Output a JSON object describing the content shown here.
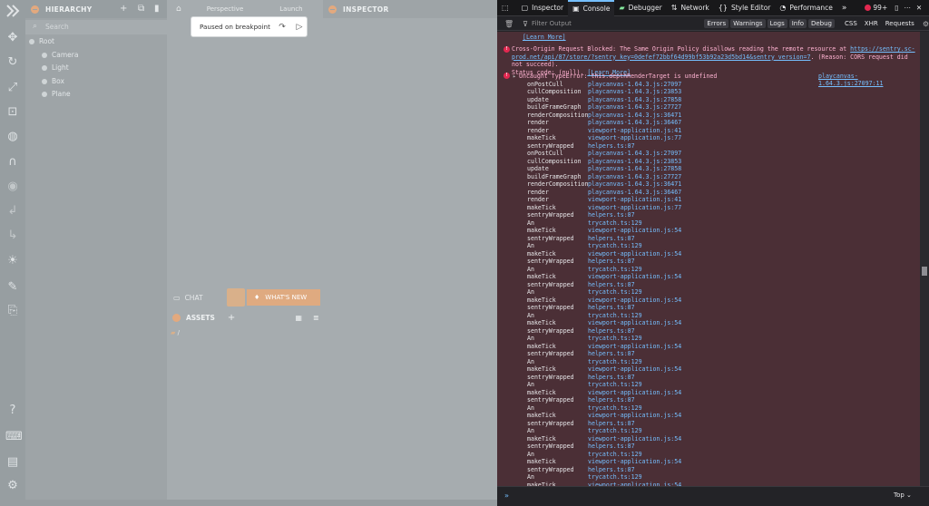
{
  "editor": {
    "hierarchy_title": "HIERARCHY",
    "search_placeholder": "Search",
    "tree": [
      "Root",
      "Camera",
      "Light",
      "Box",
      "Plane"
    ],
    "viewport_camera": "Perspective",
    "launch_label": "Launch",
    "inspector_title": "INSPECTOR",
    "paused_text": "Paused on breakpoint",
    "chat_label": "CHAT",
    "whats_new_label": "WHAT'S NEW",
    "assets_title": "ASSETS",
    "assets_path": "/"
  },
  "devtools": {
    "tabs": [
      {
        "label": "Inspector",
        "icon": "inspector-icon"
      },
      {
        "label": "Console",
        "icon": "console-icon"
      },
      {
        "label": "Debugger",
        "icon": "debugger-icon"
      },
      {
        "label": "Network",
        "icon": "network-icon"
      },
      {
        "label": "Style Editor",
        "icon": "style-editor-icon"
      },
      {
        "label": "Performance",
        "icon": "performance-icon"
      }
    ],
    "active_tab": "Console",
    "error_badge": "99+",
    "filter_placeholder": "Filter Output",
    "filters": [
      "Errors",
      "Warnings",
      "Logs",
      "Info",
      "Debug",
      "CSS",
      "XHR",
      "Requests"
    ],
    "learn_more": "[Learn More]",
    "cors_error": {
      "prefix": "Cross-Origin Request Blocked: The Same Origin Policy disallows reading the remote resource at ",
      "url": "https://sentry.sc-prod.net/api/87/store/?sentry_key=0defef72bbf64d99bf53b92a23d5bd14&sentry_version=7",
      "suffix": ". (Reason: CORS request did not succeed).",
      "status": "Status code: (null).",
      "learn_more": "[Learn More]"
    },
    "type_error": {
      "message": "Uncaught TypeError: this.depthRenderTarget is undefined",
      "location": "playcanvas-1.64.3.js:27097:11"
    },
    "stack": [
      [
        "onPostCull",
        "playcanvas-1.64.3.js:27097"
      ],
      [
        "cullComposition",
        "playcanvas-1.64.3.js:23853"
      ],
      [
        "update",
        "playcanvas-1.64.3.js:27858"
      ],
      [
        "buildFrameGraph",
        "playcanvas-1.64.3.js:27727"
      ],
      [
        "renderComposition",
        "playcanvas-1.64.3.js:36471"
      ],
      [
        "render",
        "playcanvas-1.64.3.js:36467"
      ],
      [
        "render",
        "viewport-application.js:41"
      ],
      [
        "makeTick",
        "viewport-application.js:77"
      ],
      [
        "sentryWrapped",
        "helpers.ts:87"
      ],
      [
        "onPostCull",
        "playcanvas-1.64.3.js:27097"
      ],
      [
        "cullComposition",
        "playcanvas-1.64.3.js:23853"
      ],
      [
        "update",
        "playcanvas-1.64.3.js:27858"
      ],
      [
        "buildFrameGraph",
        "playcanvas-1.64.3.js:27727"
      ],
      [
        "renderComposition",
        "playcanvas-1.64.3.js:36471"
      ],
      [
        "render",
        "playcanvas-1.64.3.js:36467"
      ],
      [
        "render",
        "viewport-application.js:41"
      ],
      [
        "makeTick",
        "viewport-application.js:77"
      ],
      [
        "sentryWrapped",
        "helpers.ts:87"
      ],
      [
        "An",
        "trycatch.ts:129"
      ],
      [
        "makeTick",
        "viewport-application.js:54"
      ],
      [
        "sentryWrapped",
        "helpers.ts:87"
      ],
      [
        "An",
        "trycatch.ts:129"
      ],
      [
        "makeTick",
        "viewport-application.js:54"
      ],
      [
        "sentryWrapped",
        "helpers.ts:87"
      ],
      [
        "An",
        "trycatch.ts:129"
      ],
      [
        "makeTick",
        "viewport-application.js:54"
      ],
      [
        "sentryWrapped",
        "helpers.ts:87"
      ],
      [
        "An",
        "trycatch.ts:129"
      ],
      [
        "makeTick",
        "viewport-application.js:54"
      ],
      [
        "sentryWrapped",
        "helpers.ts:87"
      ],
      [
        "An",
        "trycatch.ts:129"
      ],
      [
        "makeTick",
        "viewport-application.js:54"
      ],
      [
        "sentryWrapped",
        "helpers.ts:87"
      ],
      [
        "An",
        "trycatch.ts:129"
      ],
      [
        "makeTick",
        "viewport-application.js:54"
      ],
      [
        "sentryWrapped",
        "helpers.ts:87"
      ],
      [
        "An",
        "trycatch.ts:129"
      ],
      [
        "makeTick",
        "viewport-application.js:54"
      ],
      [
        "sentryWrapped",
        "helpers.ts:87"
      ],
      [
        "An",
        "trycatch.ts:129"
      ],
      [
        "makeTick",
        "viewport-application.js:54"
      ],
      [
        "sentryWrapped",
        "helpers.ts:87"
      ],
      [
        "An",
        "trycatch.ts:129"
      ],
      [
        "makeTick",
        "viewport-application.js:54"
      ],
      [
        "sentryWrapped",
        "helpers.ts:87"
      ],
      [
        "An",
        "trycatch.ts:129"
      ],
      [
        "makeTick",
        "viewport-application.js:54"
      ],
      [
        "sentryWrapped",
        "helpers.ts:87"
      ],
      [
        "An",
        "trycatch.ts:129"
      ],
      [
        "makeTick",
        "viewport-application.js:54"
      ],
      [
        "sentryWrapped",
        "helpers.ts:87"
      ],
      [
        "An",
        "trycatch.ts:129"
      ],
      [
        "makeTick",
        "viewport-application.js:54"
      ]
    ],
    "input_prompt": "»",
    "context": "Top ⌄"
  }
}
